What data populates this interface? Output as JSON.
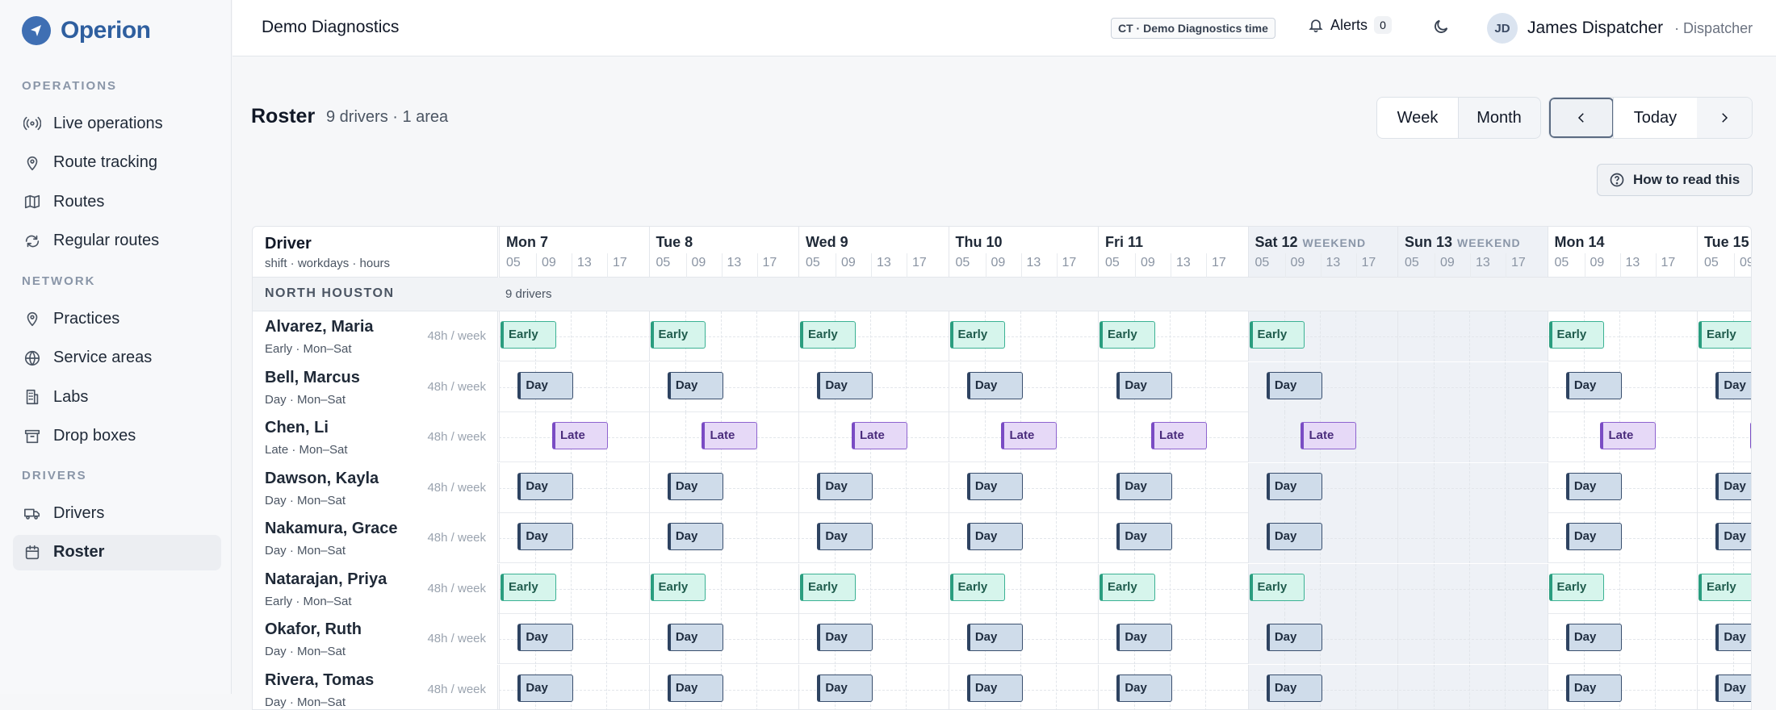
{
  "brand": {
    "name": "Operion"
  },
  "sidebar": {
    "sections": [
      {
        "label": "OPERATIONS",
        "items": [
          {
            "label": "Live operations",
            "icon": "broadcast-icon"
          },
          {
            "label": "Route tracking",
            "icon": "map-pin-icon"
          },
          {
            "label": "Routes",
            "icon": "map-icon"
          },
          {
            "label": "Regular routes",
            "icon": "repeat-icon"
          }
        ]
      },
      {
        "label": "NETWORK",
        "items": [
          {
            "label": "Practices",
            "icon": "map-pin-icon"
          },
          {
            "label": "Service areas",
            "icon": "globe-icon"
          },
          {
            "label": "Labs",
            "icon": "building-icon"
          },
          {
            "label": "Drop boxes",
            "icon": "archive-icon"
          }
        ]
      },
      {
        "label": "DRIVERS",
        "items": [
          {
            "label": "Drivers",
            "icon": "truck-icon"
          },
          {
            "label": "Roster",
            "icon": "calendar-icon",
            "active": true
          }
        ]
      }
    ]
  },
  "topbar": {
    "org": "Demo Diagnostics",
    "timezone": "CT · Demo Diagnostics time",
    "alerts_label": "Alerts",
    "alerts_count": "0",
    "user_initials": "JD",
    "user_name": "James Dispatcher",
    "user_role": "· Dispatcher"
  },
  "page": {
    "title": "Roster",
    "subtitle": "9 drivers · 1 area",
    "view_week": "Week",
    "view_month": "Month",
    "today": "Today",
    "how_to": "How to read this"
  },
  "grid": {
    "driver_header": "Driver",
    "driver_subheader": "shift · workdays · hours",
    "hours": [
      "05",
      "09",
      "13",
      "17"
    ],
    "weekend_tag": "WEEKEND",
    "days": [
      {
        "label": "Mon 7",
        "weekend": false
      },
      {
        "label": "Tue 8",
        "weekend": false
      },
      {
        "label": "Wed 9",
        "weekend": false
      },
      {
        "label": "Thu 10",
        "weekend": false
      },
      {
        "label": "Fri 11",
        "weekend": false
      },
      {
        "label": "Sat 12",
        "weekend": true
      },
      {
        "label": "Sun 13",
        "weekend": true
      },
      {
        "label": "Mon 14",
        "weekend": false
      },
      {
        "label": "Tue 15",
        "weekend": false
      }
    ],
    "area": {
      "name": "NORTH HOUSTON",
      "count": "9 drivers"
    },
    "shift_types": {
      "Early": {
        "start": 4,
        "end": 12
      },
      "Day": {
        "start": 7,
        "end": 15
      },
      "Late": {
        "start": 13,
        "end": 21
      }
    },
    "drivers": [
      {
        "name": "Alvarez, Maria",
        "sub": "Early · Mon–Sat",
        "hours": "48h / week",
        "shift": "Early",
        "days": [
          0,
          1,
          2,
          3,
          4,
          5,
          7,
          8
        ]
      },
      {
        "name": "Bell, Marcus",
        "sub": "Day · Mon–Sat",
        "hours": "48h / week",
        "shift": "Day",
        "days": [
          0,
          1,
          2,
          3,
          4,
          5,
          7,
          8
        ]
      },
      {
        "name": "Chen, Li",
        "sub": "Late · Mon–Sat",
        "hours": "48h / week",
        "shift": "Late",
        "days": [
          0,
          1,
          2,
          3,
          4,
          5,
          7,
          8
        ]
      },
      {
        "name": "Dawson, Kayla",
        "sub": "Day · Mon–Sat",
        "hours": "48h / week",
        "shift": "Day",
        "days": [
          0,
          1,
          2,
          3,
          4,
          5,
          7,
          8
        ]
      },
      {
        "name": "Nakamura, Grace",
        "sub": "Day · Mon–Sat",
        "hours": "48h / week",
        "shift": "Day",
        "days": [
          0,
          1,
          2,
          3,
          4,
          5,
          7,
          8
        ]
      },
      {
        "name": "Natarajan, Priya",
        "sub": "Early · Mon–Sat",
        "hours": "48h / week",
        "shift": "Early",
        "days": [
          0,
          1,
          2,
          3,
          4,
          5,
          7,
          8
        ]
      },
      {
        "name": "Okafor, Ruth",
        "sub": "Day · Mon–Sat",
        "hours": "48h / week",
        "shift": "Day",
        "days": [
          0,
          1,
          2,
          3,
          4,
          5,
          7,
          8
        ]
      },
      {
        "name": "Rivera, Tomas",
        "sub": "Day · Mon–Sat",
        "hours": "48h / week",
        "shift": "Day",
        "days": [
          0,
          1,
          2,
          3,
          4,
          5,
          7,
          8
        ]
      }
    ]
  }
}
